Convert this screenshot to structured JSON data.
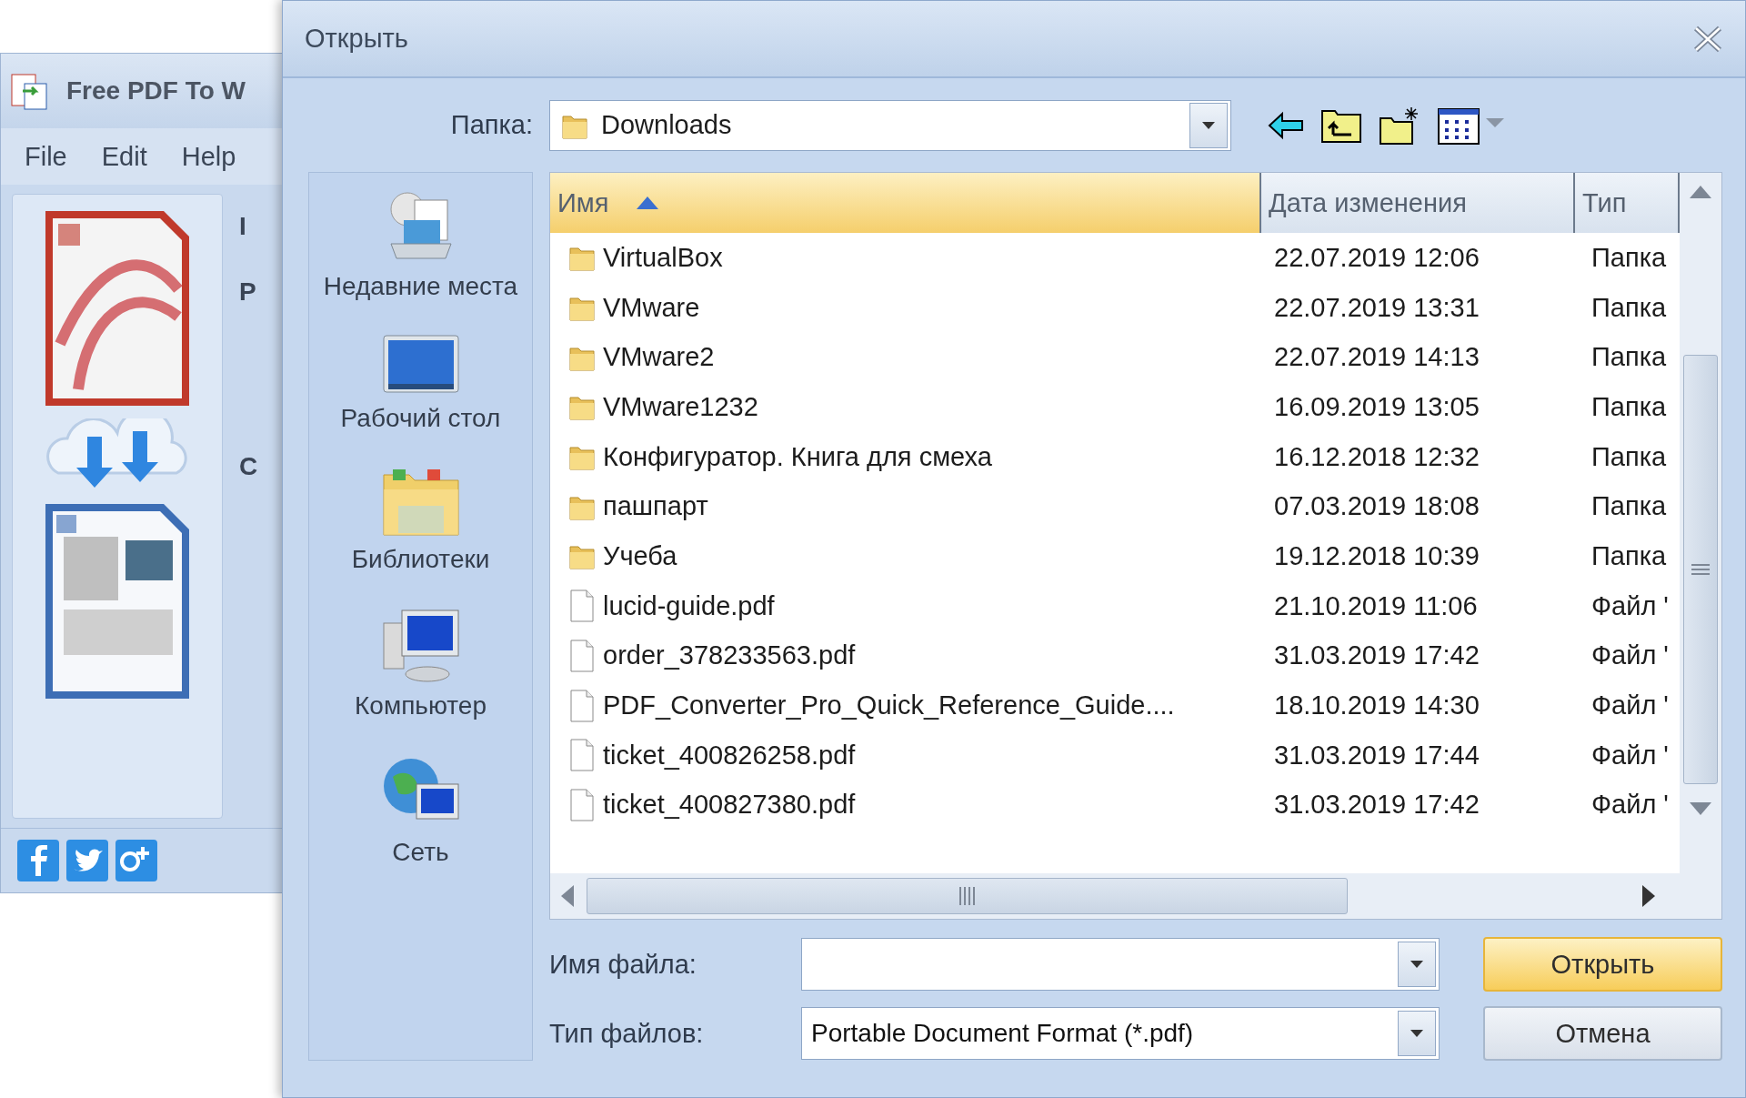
{
  "app_window": {
    "title": "Free PDF To W",
    "menu": [
      "File",
      "Edit",
      "Help"
    ],
    "panel_labels": [
      "I",
      "P",
      "C"
    ]
  },
  "dialog": {
    "title": "Открыть",
    "folder_label": "Папка:",
    "folder": "Downloads",
    "places": [
      {
        "label": "Недавние места",
        "kind": "recent"
      },
      {
        "label": "Рабочий стол",
        "kind": "desktop"
      },
      {
        "label": "Библиотеки",
        "kind": "libraries"
      },
      {
        "label": "Компьютер",
        "kind": "computer"
      },
      {
        "label": "Сеть",
        "kind": "network"
      }
    ],
    "columns": [
      {
        "label": "Имя",
        "sorted": true
      },
      {
        "label": "Дата изменения",
        "sorted": false
      },
      {
        "label": "Тип",
        "sorted": false
      }
    ],
    "rows": [
      {
        "name": "VirtualBox",
        "date": "22.07.2019 12:06",
        "type": "Папка",
        "kind": "folder"
      },
      {
        "name": "VMware",
        "date": "22.07.2019 13:31",
        "type": "Папка",
        "kind": "folder"
      },
      {
        "name": "VMware2",
        "date": "22.07.2019 14:13",
        "type": "Папка",
        "kind": "folder"
      },
      {
        "name": "VMware1232",
        "date": "16.09.2019 13:05",
        "type": "Папка",
        "kind": "folder"
      },
      {
        "name": "Конфигуратор. Книга для смеха",
        "date": "16.12.2018 12:32",
        "type": "Папка",
        "kind": "folder"
      },
      {
        "name": "пашпарт",
        "date": "07.03.2019 18:08",
        "type": "Папка",
        "kind": "folder"
      },
      {
        "name": "Учеба",
        "date": "19.12.2018 10:39",
        "type": "Папка",
        "kind": "folder"
      },
      {
        "name": "lucid-guide.pdf",
        "date": "21.10.2019 11:06",
        "type": "Файл '",
        "kind": "file"
      },
      {
        "name": "order_378233563.pdf",
        "date": "31.03.2019 17:42",
        "type": "Файл '",
        "kind": "file"
      },
      {
        "name": "PDF_Converter_Pro_Quick_Reference_Guide....",
        "date": "18.10.2019 14:30",
        "type": "Файл '",
        "kind": "file"
      },
      {
        "name": "ticket_400826258.pdf",
        "date": "31.03.2019 17:44",
        "type": "Файл '",
        "kind": "file"
      },
      {
        "name": "ticket_400827380.pdf",
        "date": "31.03.2019 17:42",
        "type": "Файл '",
        "kind": "file"
      }
    ],
    "filename_label": "Имя файла:",
    "filetype_label": "Тип файлов:",
    "filetype": "Portable Document Format (*.pdf)",
    "buttons": [
      {
        "label": "Открыть",
        "default": true
      },
      {
        "label": "Отмена",
        "default": false
      }
    ]
  }
}
